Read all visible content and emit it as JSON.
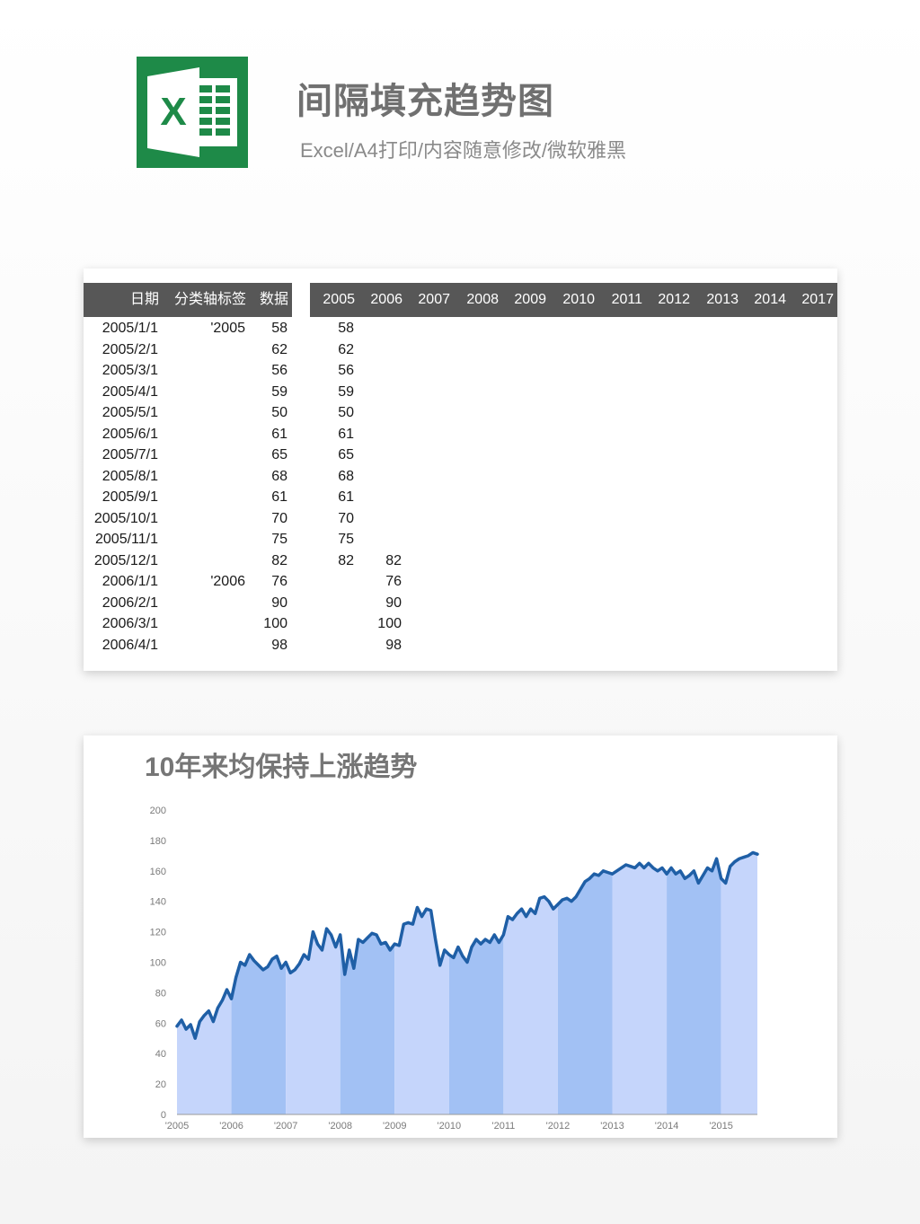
{
  "header": {
    "title": "间隔填充趋势图",
    "subtitle": "Excel/A4打印/内容随意修改/微软雅黑",
    "logo_icon": "excel-logo-icon",
    "logo_letter": "X"
  },
  "table": {
    "left_headers": [
      "日期",
      "分类轴标签",
      "数据"
    ],
    "year_headers": [
      "2005",
      "2006",
      "2007",
      "2008",
      "2009",
      "2010",
      "2011",
      "2012",
      "2013",
      "2014",
      "2017"
    ],
    "rows": [
      {
        "date": "2005/1/1",
        "label": "'2005",
        "value": "58",
        "y2005": "58",
        "y2006": ""
      },
      {
        "date": "2005/2/1",
        "label": "",
        "value": "62",
        "y2005": "62",
        "y2006": ""
      },
      {
        "date": "2005/3/1",
        "label": "",
        "value": "56",
        "y2005": "56",
        "y2006": ""
      },
      {
        "date": "2005/4/1",
        "label": "",
        "value": "59",
        "y2005": "59",
        "y2006": ""
      },
      {
        "date": "2005/5/1",
        "label": "",
        "value": "50",
        "y2005": "50",
        "y2006": ""
      },
      {
        "date": "2005/6/1",
        "label": "",
        "value": "61",
        "y2005": "61",
        "y2006": ""
      },
      {
        "date": "2005/7/1",
        "label": "",
        "value": "65",
        "y2005": "65",
        "y2006": ""
      },
      {
        "date": "2005/8/1",
        "label": "",
        "value": "68",
        "y2005": "68",
        "y2006": ""
      },
      {
        "date": "2005/9/1",
        "label": "",
        "value": "61",
        "y2005": "61",
        "y2006": ""
      },
      {
        "date": "2005/10/1",
        "label": "",
        "value": "70",
        "y2005": "70",
        "y2006": ""
      },
      {
        "date": "2005/11/1",
        "label": "",
        "value": "75",
        "y2005": "75",
        "y2006": ""
      },
      {
        "date": "2005/12/1",
        "label": "",
        "value": "82",
        "y2005": "82",
        "y2006": "82"
      },
      {
        "date": "2006/1/1",
        "label": "'2006",
        "value": "76",
        "y2005": "",
        "y2006": "76"
      },
      {
        "date": "2006/2/1",
        "label": "",
        "value": "90",
        "y2005": "",
        "y2006": "90"
      },
      {
        "date": "2006/3/1",
        "label": "",
        "value": "100",
        "y2005": "",
        "y2006": "100"
      },
      {
        "date": "2006/4/1",
        "label": "",
        "value": "98",
        "y2005": "",
        "y2006": "98"
      }
    ]
  },
  "colors": {
    "line": "#1f5fa6",
    "band_light": "#c5d5fb",
    "band_dark": "#a2c1f4",
    "header_bg": "#575757",
    "excel_green": "#1e8a48"
  },
  "chart_data": {
    "type": "area",
    "title": "10年来均保持上涨趋势",
    "xlabel": "",
    "ylabel": "",
    "ylim": [
      0,
      200
    ],
    "yticks": [
      "0",
      "20",
      "40",
      "60",
      "80",
      "100",
      "120",
      "140",
      "160",
      "180",
      "200"
    ],
    "xticks": [
      "'2005",
      "'2006",
      "'2007",
      "'2008",
      "'2009",
      "'2010",
      "'2011",
      "'2012",
      "'2013",
      "'2014",
      "'2015"
    ],
    "grid": false,
    "legend": "none",
    "band_styles": [
      "light",
      "dark",
      "light",
      "dark",
      "light",
      "dark",
      "light",
      "dark",
      "light",
      "dark",
      "light"
    ],
    "series": [
      {
        "values": [
          58,
          62,
          56,
          59,
          50,
          61,
          65,
          68,
          61,
          70,
          75,
          82,
          76,
          90,
          100,
          98,
          105,
          101,
          98,
          95,
          97,
          102,
          104,
          96,
          100,
          93,
          95,
          99,
          105,
          102,
          120,
          112,
          108,
          122,
          118,
          110,
          118,
          92,
          108,
          96,
          115,
          113,
          116,
          119,
          118,
          112,
          113,
          108,
          112,
          111,
          125,
          126,
          125,
          136,
          130,
          135,
          134,
          115,
          98,
          108,
          105,
          103,
          110,
          104,
          100,
          110,
          115,
          112,
          115,
          113,
          118,
          113,
          118,
          130,
          128,
          132,
          135,
          130,
          135,
          132,
          142,
          143,
          140,
          135,
          138,
          141,
          142,
          140,
          143,
          148,
          153,
          155,
          158,
          157,
          160,
          159,
          158,
          160,
          162,
          164,
          163,
          162,
          165,
          162,
          165,
          162,
          160,
          162,
          158,
          162,
          158,
          160,
          155,
          157,
          160,
          152,
          157,
          162,
          160,
          168,
          155,
          152,
          163,
          166,
          168,
          169,
          170,
          172,
          171
        ]
      }
    ]
  }
}
